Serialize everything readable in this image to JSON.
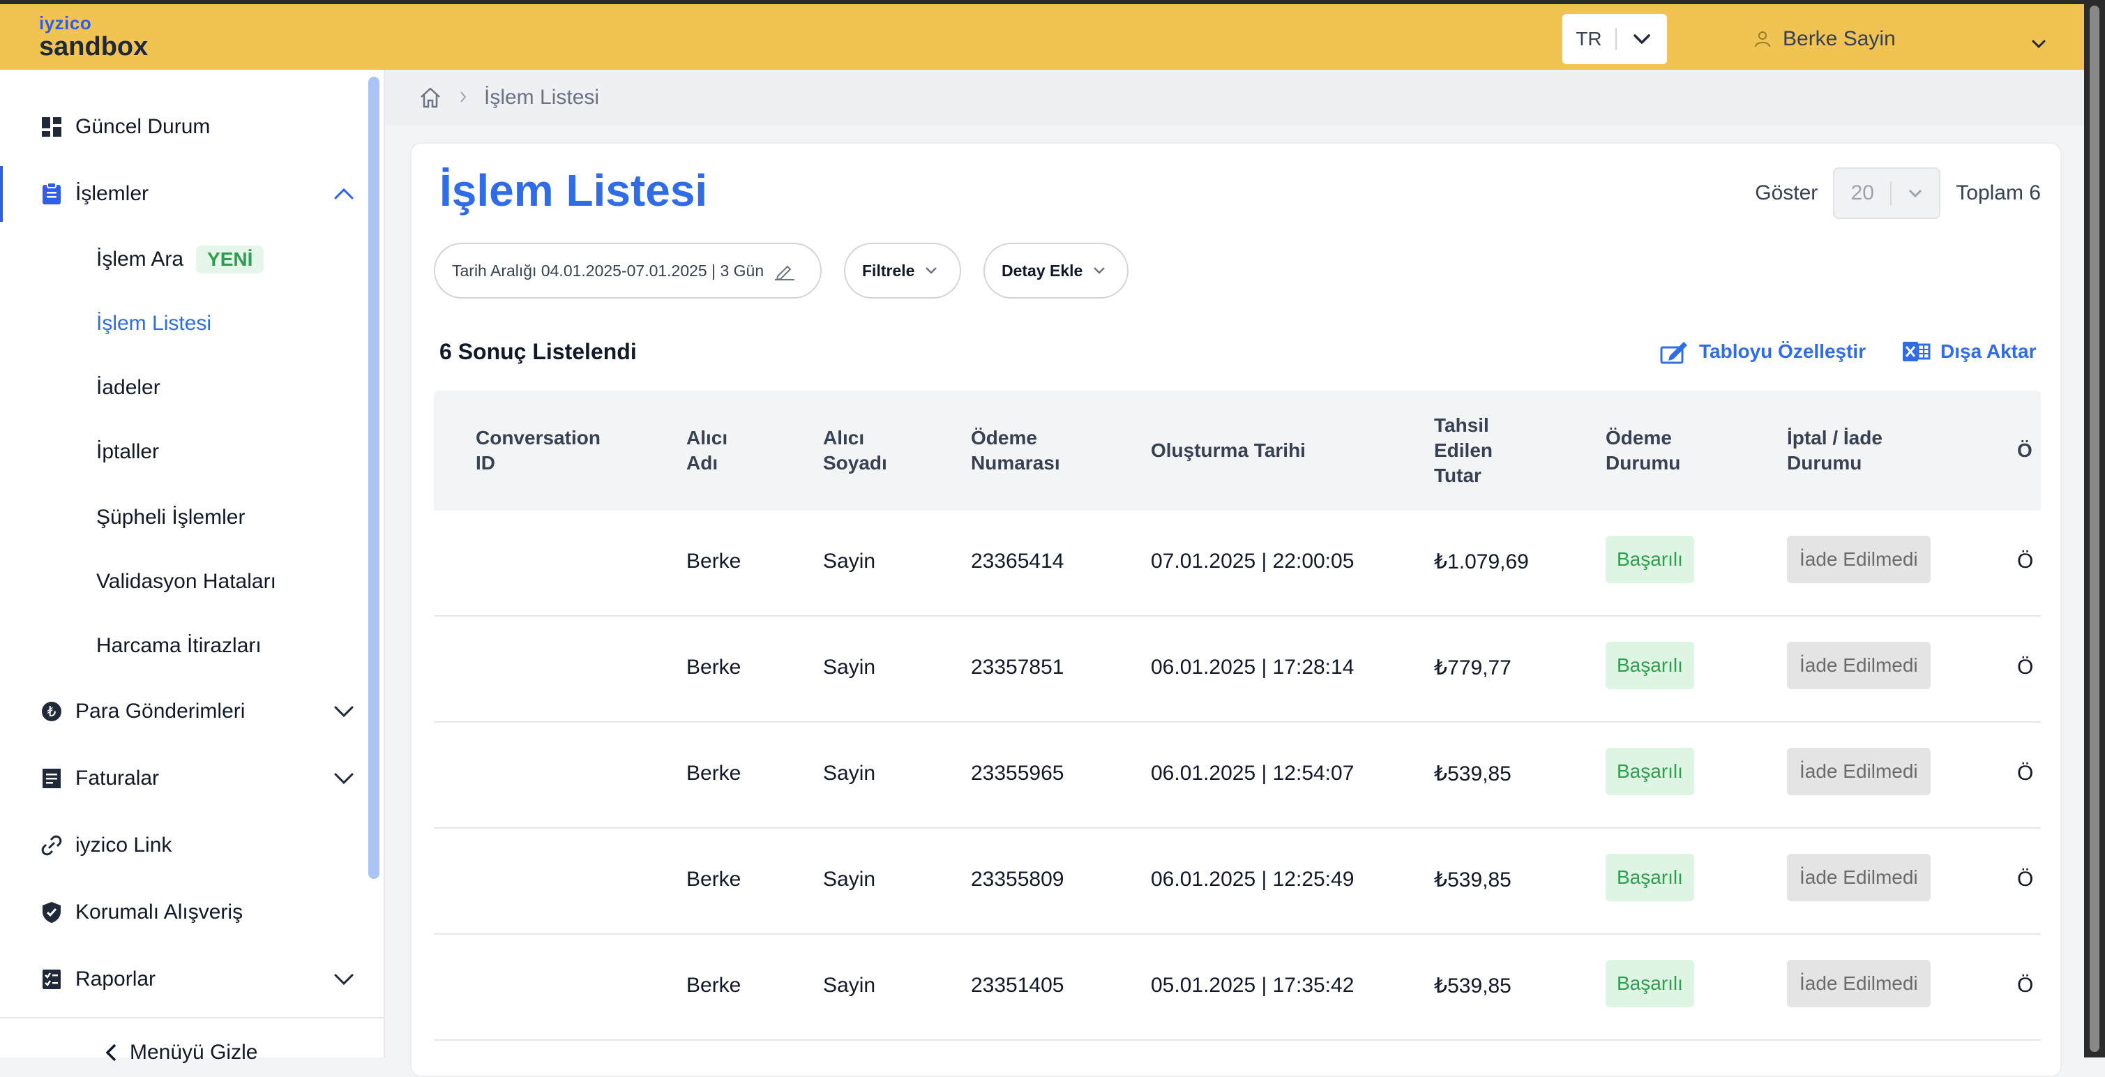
{
  "brand": {
    "line1": "iyzico",
    "line2": "sandbox"
  },
  "language": {
    "selected": "TR"
  },
  "user": {
    "name": "Berke Sayin"
  },
  "sidebar": {
    "items": [
      {
        "label": "Güncel Durum",
        "icon": "dashboard-icon"
      },
      {
        "label": "İşlemler",
        "icon": "clipboard-icon",
        "expanded": true,
        "active": true
      },
      {
        "label": "Para Gönderimleri",
        "icon": "lira-coin-icon"
      },
      {
        "label": "Faturalar",
        "icon": "invoice-icon"
      },
      {
        "label": "iyzico Link",
        "icon": "link-icon"
      },
      {
        "label": "Korumalı Alışveriş",
        "icon": "shield-icon"
      },
      {
        "label": "Raporlar",
        "icon": "report-icon"
      }
    ],
    "sub_items": [
      {
        "label": "İşlem Ara",
        "badge": "YENİ"
      },
      {
        "label": "İşlem Listesi",
        "active": true
      },
      {
        "label": "İadeler"
      },
      {
        "label": "İptaller"
      },
      {
        "label": "Şüpheli İşlemler"
      },
      {
        "label": "Validasyon Hataları"
      },
      {
        "label": "Harcama İtirazları"
      }
    ],
    "hide_menu": "Menüyü Gizle"
  },
  "breadcrumb": {
    "current": "İşlem Listesi"
  },
  "page": {
    "title": "İşlem Listesi",
    "show_label": "Göster",
    "page_size": "20",
    "total": "Toplam 6"
  },
  "filters": {
    "date_label": "Tarih Aralığı",
    "date_range": "04.01.2025-07.01.2025",
    "date_days": "| 3 Gün",
    "filter": "Filtrele",
    "add_detail": "Detay Ekle"
  },
  "results": {
    "count_text": "6 Sonuç Listelendi",
    "customize": "Tabloyu Özelleştir",
    "export": "Dışa Aktar"
  },
  "table": {
    "headers": [
      [
        "Conversation",
        "ID"
      ],
      [
        "Alıcı",
        "Adı"
      ],
      [
        "Alıcı",
        "Soyadı"
      ],
      [
        "Ödeme",
        "Numarası"
      ],
      [
        "Oluşturma Tarihi"
      ],
      [
        "Tahsil",
        "Edilen",
        "Tutar"
      ],
      [
        "Ödeme",
        "Durumu"
      ],
      [
        "İptal / İade",
        "Durumu"
      ],
      [
        "Ö"
      ]
    ],
    "rows": [
      {
        "conv": "",
        "name": "Berke",
        "surname": "Sayin",
        "payment_no": "23365414",
        "created": "07.01.2025 | 22:00:05",
        "amount": "₺1.079,69",
        "status": "Başarılı",
        "refund": "İade Edilmedi",
        "extra": "Ö"
      },
      {
        "conv": "",
        "name": "Berke",
        "surname": "Sayin",
        "payment_no": "23357851",
        "created": "06.01.2025 | 17:28:14",
        "amount": "₺779,77",
        "status": "Başarılı",
        "refund": "İade Edilmedi",
        "extra": "Ö"
      },
      {
        "conv": "",
        "name": "Berke",
        "surname": "Sayin",
        "payment_no": "23355965",
        "created": "06.01.2025 | 12:54:07",
        "amount": "₺539,85",
        "status": "Başarılı",
        "refund": "İade Edilmedi",
        "extra": "Ö"
      },
      {
        "conv": "",
        "name": "Berke",
        "surname": "Sayin",
        "payment_no": "23355809",
        "created": "06.01.2025 | 12:25:49",
        "amount": "₺539,85",
        "status": "Başarılı",
        "refund": "İade Edilmedi",
        "extra": "Ö"
      },
      {
        "conv": "",
        "name": "Berke",
        "surname": "Sayin",
        "payment_no": "23351405",
        "created": "05.01.2025 | 17:35:42",
        "amount": "₺539,85",
        "status": "Başarılı",
        "refund": "İade Edilmedi",
        "extra": "Ö"
      }
    ]
  },
  "colors": {
    "topbar": "#f0c352",
    "accent": "#2f6ce5",
    "success_bg": "#dff5e4",
    "success_text": "#2e9d4d"
  }
}
